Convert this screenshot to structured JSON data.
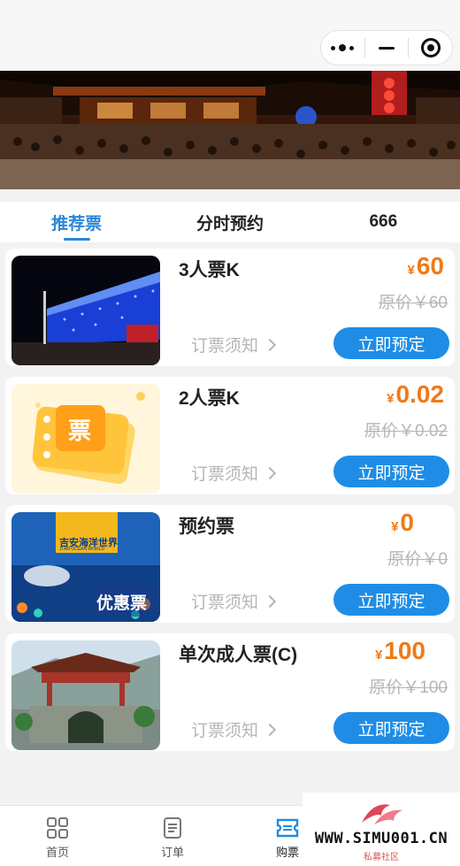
{
  "capsule": {
    "more": "more-icon",
    "minimize": "minimize-icon",
    "close": "close-target-icon"
  },
  "tabs": [
    {
      "label": "推荐票",
      "active": true
    },
    {
      "label": "分时预约",
      "active": false
    },
    {
      "label": "666",
      "active": false
    }
  ],
  "tickets": [
    {
      "name": "3人票K",
      "currency": "¥",
      "price": "60",
      "original": "原价￥60",
      "notice": "订票须知",
      "button": "立即预定"
    },
    {
      "name": "2人票K",
      "currency": "¥",
      "price": "0.02",
      "original": "原价￥0.02",
      "notice": "订票须知",
      "button": "立即预定"
    },
    {
      "name": "预约票",
      "currency": "¥",
      "price": "0",
      "original": "原价￥0",
      "notice": "订票须知",
      "button": "立即预定",
      "thumb_logo": "吉安海洋世界",
      "thumb_logo_sub": "JI AN OCEAN WORLD",
      "thumb_caption": "优惠票"
    },
    {
      "name": "单次成人票(C)",
      "currency": "¥",
      "price": "100",
      "original": "原价￥100",
      "notice": "订票须知",
      "button": "立即预定"
    }
  ],
  "ticket2_thumb_text": "票",
  "nav": [
    {
      "label": "首页",
      "icon": "grid-icon"
    },
    {
      "label": "订单",
      "icon": "document-icon"
    },
    {
      "label": "购票",
      "icon": "ticket-icon",
      "active": true
    }
  ],
  "watermark": {
    "text": "WWW.SIMU001.CN",
    "sub": "私募社区"
  },
  "colors": {
    "accent": "#2b86d9",
    "button": "#1f8de6",
    "price": "#f07a17"
  }
}
